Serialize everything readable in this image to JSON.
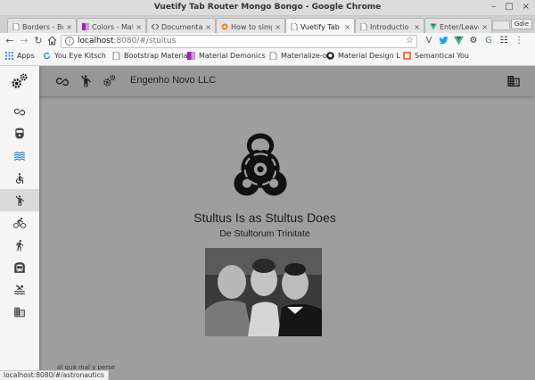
{
  "window": {
    "title": "Vuetify Tab Router Mongo Bongo - Google Chrome",
    "controls": [
      "–",
      "□",
      "×"
    ]
  },
  "tabs": [
    {
      "label": "Borders - Bo",
      "active": false,
      "favicon": "page-icon"
    },
    {
      "label": "Colors - Mat",
      "active": false,
      "favicon": "material-icon"
    },
    {
      "label": "Documentati",
      "active": false,
      "favicon": "code-icon"
    },
    {
      "label": "How to simp",
      "active": false,
      "favicon": "stackoverflow-icon"
    },
    {
      "label": "Vuetify Tab",
      "active": true,
      "favicon": "page-icon"
    },
    {
      "label": "Introductio",
      "active": false,
      "favicon": "page-icon"
    },
    {
      "label": "Enter/Leave",
      "active": false,
      "favicon": "vue-icon"
    }
  ],
  "tab_close": "×",
  "profile_chip": "Gdle",
  "omnibox": {
    "host": "localhost",
    "path": ":8080/#/stultus"
  },
  "bookmarks": [
    {
      "label": "Apps",
      "icon": "apps-icon"
    },
    {
      "label": "You Eye Kitsch",
      "icon": "refresh-icon"
    },
    {
      "label": "Bootstrap Materia",
      "icon": "page-icon"
    },
    {
      "label": "Material Demonics",
      "icon": "material-icon"
    },
    {
      "label": "Materialize-o",
      "icon": "page-icon"
    },
    {
      "label": "Material Design L",
      "icon": "github-icon"
    },
    {
      "label": "Semantical You",
      "icon": "semantic-icon"
    }
  ],
  "sidebar": {
    "items": [
      {
        "icon": "infinity-icon"
      },
      {
        "icon": "train-icon"
      },
      {
        "icon": "waves-icon",
        "selected": true
      },
      {
        "icon": "accessible-icon"
      },
      {
        "icon": "person-icon",
        "active": true
      },
      {
        "icon": "bike-icon"
      },
      {
        "icon": "run-icon"
      },
      {
        "icon": "subway-icon"
      },
      {
        "icon": "pool-icon"
      },
      {
        "icon": "building-icon"
      }
    ]
  },
  "appbar": {
    "title": "Engenho Novo LLC"
  },
  "hero": {
    "title": "Stultus Is as Stultus Does",
    "subtitle": "De Stultorum Trinitate"
  },
  "footer": {
    "text": "al quà mal y perse"
  },
  "status": {
    "url": "localhost:8080/#/astronautics"
  },
  "colors": {
    "accent_blue": "#1976d2",
    "page_gray": "#9e9e9e",
    "appbar_gray": "#979797",
    "sidebar_bg": "#f5f5f5"
  }
}
